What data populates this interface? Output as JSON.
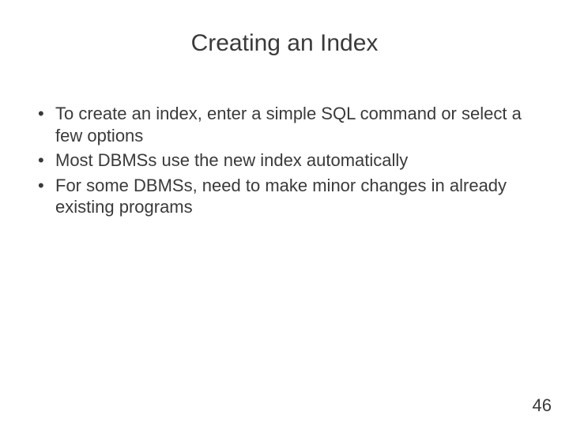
{
  "slide": {
    "title": "Creating an Index",
    "bullets": [
      "To create an index, enter a simple SQL command or select a few options",
      "Most DBMSs use the new index automatically",
      "For some DBMSs, need to make minor changes in already existing programs"
    ],
    "page_number": "46"
  }
}
